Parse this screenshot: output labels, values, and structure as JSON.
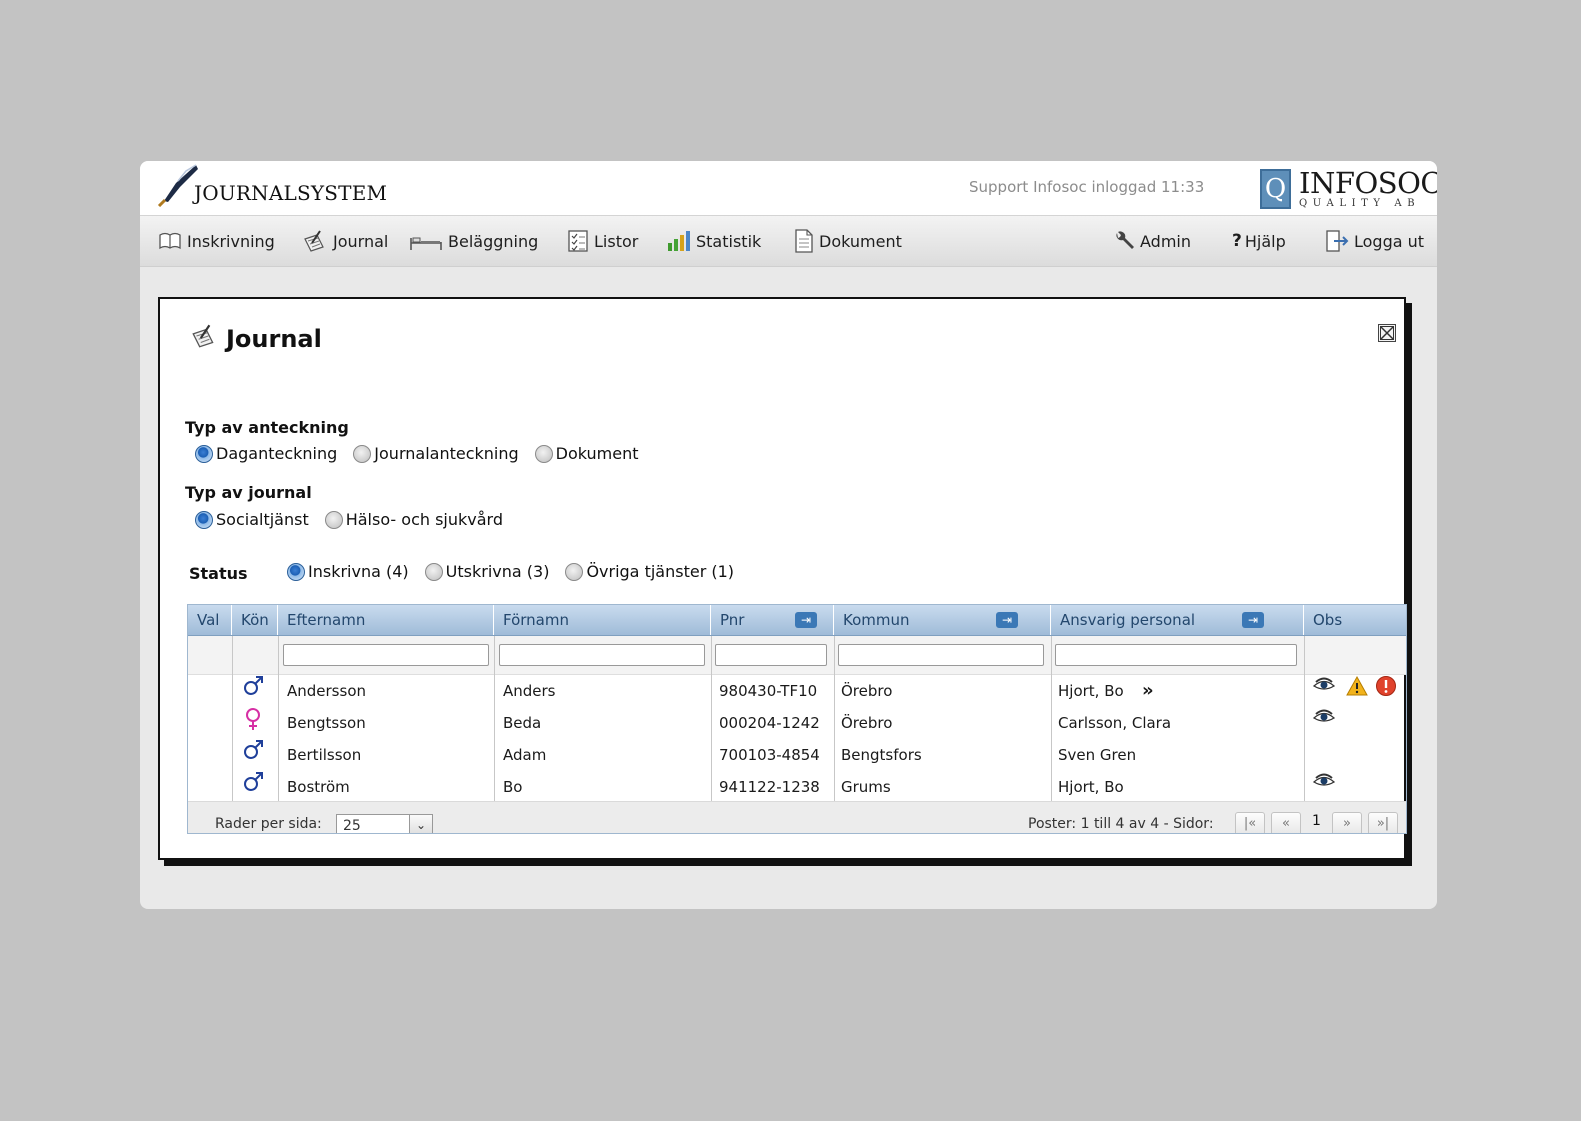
{
  "header": {
    "app_name": "JOURNALSYSTEM",
    "login_info": "Support Infosoc inloggad 11:33",
    "brand_letter": "Q",
    "brand_name": "INFOSOC",
    "brand_sub": "QUALITY AB"
  },
  "nav": {
    "left": [
      {
        "label": "Inskrivning",
        "icon": "book-icon"
      },
      {
        "label": "Journal",
        "icon": "journal-icon"
      },
      {
        "label": "Beläggning",
        "icon": "bed-icon"
      },
      {
        "label": "Listor",
        "icon": "checklist-icon"
      },
      {
        "label": "Statistik",
        "icon": "bar-chart-icon"
      },
      {
        "label": "Dokument",
        "icon": "document-icon"
      }
    ],
    "right": [
      {
        "label": "Admin",
        "icon": "wrench-icon"
      },
      {
        "label": "Hjälp",
        "icon": "question-icon"
      },
      {
        "label": "Logga ut",
        "icon": "logout-icon"
      }
    ]
  },
  "panel": {
    "title": "Journal",
    "note_type": {
      "label": "Typ av anteckning",
      "options": [
        "Daganteckning",
        "Journalanteckning",
        "Dokument"
      ],
      "selected": 0
    },
    "journal_type": {
      "label": "Typ av journal",
      "options": [
        "Socialtjänst",
        "Hälso- och sjukvård"
      ],
      "selected": 0
    },
    "status": {
      "label": "Status",
      "options": [
        "Inskrivna (4)",
        "Utskrivna (3)",
        "Övriga tjänster (1)"
      ],
      "selected": 0
    }
  },
  "grid": {
    "columns": [
      "Val",
      "Kön",
      "Efternamn",
      "Förnamn",
      "Pnr",
      "Kommun",
      "Ansvarig personal",
      "Obs"
    ],
    "rows": [
      {
        "gender": "male",
        "efternamn": "Andersson",
        "fornamn": "Anders",
        "pnr": "980430-TF10",
        "kommun": "Örebro",
        "personal": "Hjort, Bo",
        "more": "»",
        "obs": [
          "eye",
          "warning",
          "alert"
        ]
      },
      {
        "gender": "female",
        "efternamn": "Bengtsson",
        "fornamn": "Beda",
        "pnr": "000204-1242",
        "kommun": "Örebro",
        "personal": "Carlsson, Clara",
        "more": "",
        "obs": [
          "eye"
        ]
      },
      {
        "gender": "male",
        "efternamn": "Bertilsson",
        "fornamn": "Adam",
        "pnr": "700103-4854",
        "kommun": "Bengtsfors",
        "personal": "Sven Gren",
        "more": "",
        "obs": []
      },
      {
        "gender": "male",
        "efternamn": "Boström",
        "fornamn": "Bo",
        "pnr": "941122-1238",
        "kommun": "Grums",
        "personal": "Hjort, Bo",
        "more": "",
        "obs": [
          "eye"
        ]
      }
    ],
    "pager": {
      "rows_label": "Rader per sida:",
      "rows_value": "25",
      "info": "Poster: 1 till 4 av 4 - Sidor:",
      "current_page": "1",
      "first": "|«",
      "prev": "«",
      "next": "»",
      "last": "»|"
    }
  },
  "colors": {
    "male": "#1f3f9a",
    "female": "#d62fa4",
    "header_text": "#23476d",
    "radio_on": "#1c5fb4"
  }
}
